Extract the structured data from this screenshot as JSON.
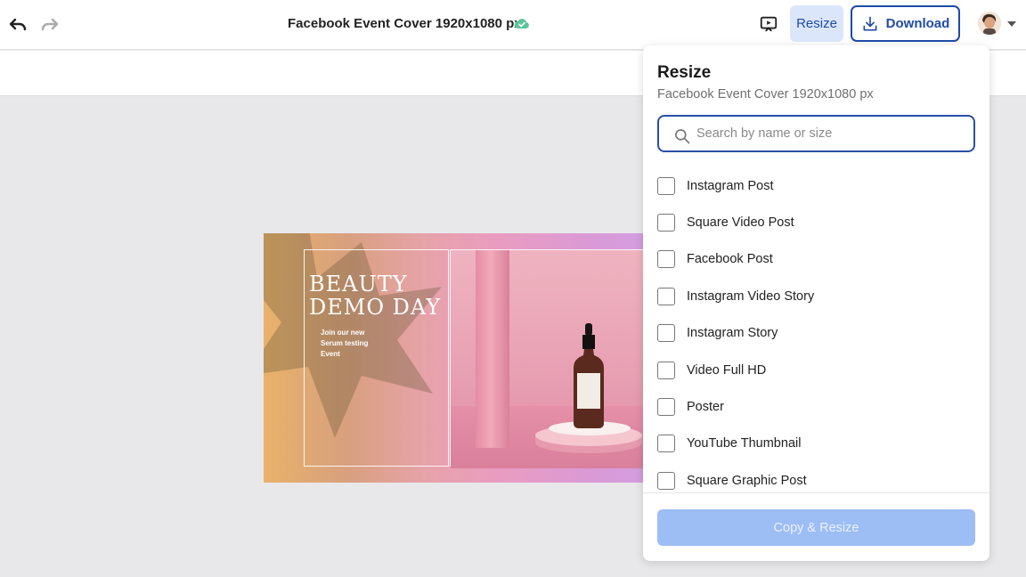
{
  "header": {
    "document_title": "Facebook Event Cover 1920x1080 px",
    "resize_label": "Resize",
    "download_label": "Download"
  },
  "design": {
    "title_line1": "BEAUTY",
    "title_line2": "DEMO DAY",
    "subtitle_line1": "Join our new",
    "subtitle_line2": "Serum testing",
    "subtitle_line3": "Event"
  },
  "panel": {
    "title": "Resize",
    "subtitle": "Facebook Event Cover 1920x1080 px",
    "search_placeholder": "Search by name or size",
    "items": [
      {
        "label": "Instagram Post"
      },
      {
        "label": "Square Video Post"
      },
      {
        "label": "Facebook Post"
      },
      {
        "label": "Instagram Video Story"
      },
      {
        "label": "Instagram Story"
      },
      {
        "label": "Video Full HD"
      },
      {
        "label": "Poster"
      },
      {
        "label": "YouTube Thumbnail"
      },
      {
        "label": "Square Graphic Post"
      }
    ],
    "copy_resize_label": "Copy & Resize"
  },
  "colors": {
    "accent": "#1f4ba8",
    "resize_active_bg": "#dbe6fb",
    "disabled_button": "#9dbdf5",
    "cloud_saved": "#5cc49b"
  },
  "icons": [
    "undo-icon",
    "redo-icon",
    "cloud-check-icon",
    "present-icon",
    "download-icon",
    "avatar",
    "caret-down-icon",
    "search-icon"
  ]
}
